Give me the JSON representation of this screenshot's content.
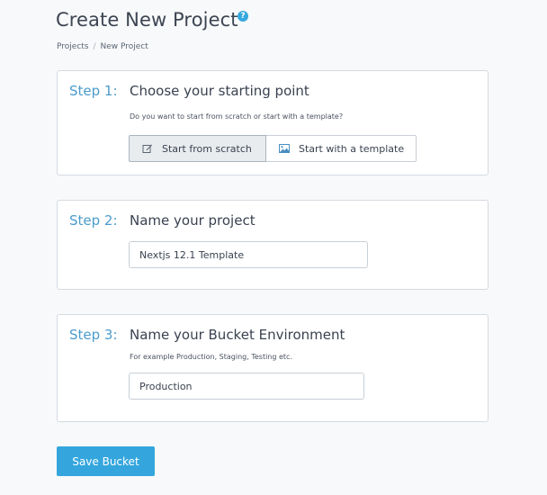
{
  "page": {
    "title": "Create New Project",
    "help_icon": "question-circle-icon",
    "help_glyph": "?"
  },
  "breadcrumb": {
    "items": [
      "Projects",
      "New Project"
    ],
    "separator": "/"
  },
  "step1": {
    "label": "Step 1:",
    "title": "Choose your starting point",
    "hint": "Do you want to start from scratch or start with a template?",
    "options": [
      {
        "label": "Start from scratch",
        "icon": "pencil-edit-icon",
        "selected": true
      },
      {
        "label": "Start with a template",
        "icon": "image-icon",
        "selected": false
      }
    ]
  },
  "step2": {
    "label": "Step 2:",
    "title": "Name your project",
    "input_value": "Nextjs 12.1 Template"
  },
  "step3": {
    "label": "Step 3:",
    "title": "Name your Bucket Environment",
    "hint": "For example Production, Staging, Testing etc.",
    "input_value": "Production"
  },
  "actions": {
    "save_label": "Save Bucket"
  },
  "colors": {
    "accent": "#34a6dd",
    "step_label": "#4b9ccc",
    "background": "#f7f9fb"
  }
}
